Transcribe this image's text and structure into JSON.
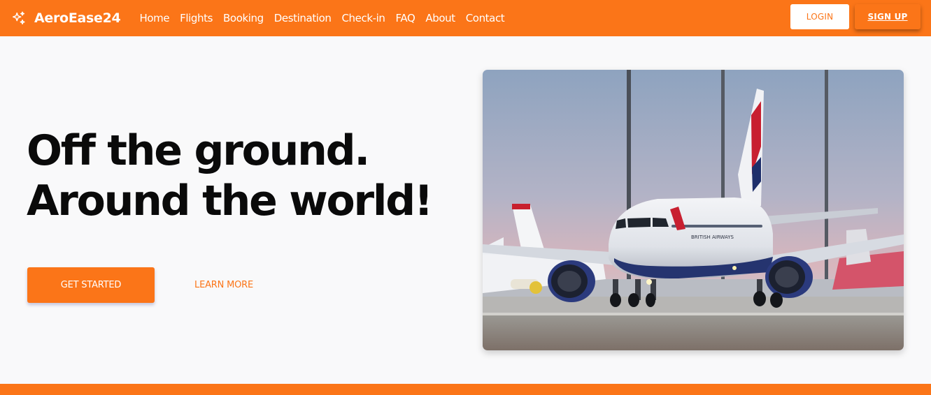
{
  "brand": {
    "name": "AeroEase24",
    "icon": "sparkles-icon"
  },
  "nav": {
    "links": [
      "Home",
      "Flights",
      "Booking",
      "Destination",
      "Check-in",
      "FAQ",
      "About",
      "Contact"
    ],
    "login_label": "LOGIN",
    "signup_label": "SIGN UP"
  },
  "hero": {
    "title_line1": "Off the ground.",
    "title_line2": "Around the world!",
    "primary_cta": "GET STARTED",
    "secondary_cta": "LEARN MORE",
    "image_icon": "airplane-photo"
  },
  "colors": {
    "accent": "#fb7518",
    "background": "#f9f9fa",
    "text": "#0a0a0a"
  }
}
